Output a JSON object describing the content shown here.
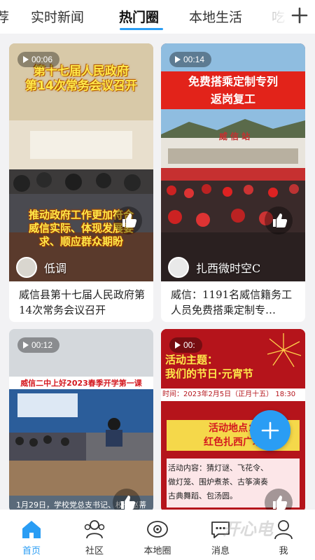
{
  "tabs": [
    "荐",
    "实时新闻",
    "热门圈",
    "本地生活",
    "吃"
  ],
  "active_tab": "热门圈",
  "cards": [
    {
      "duration": "00:06",
      "headline_top": "第十七届人民政府\n第14次常务会议召开",
      "headline_bottom": "推动政府工作更加符合\n威信实际、体现发展要\n求、顺应群众期盼",
      "author": "低调",
      "caption": "威信县第十七届人民政府第14次常务会议召开"
    },
    {
      "duration": "00:14",
      "headline_top": "免费搭乘定制专列\n返岗复工",
      "station_sign": "威 信 站",
      "author": "扎西微时空C",
      "caption": "威信：1191名威信籍务工人员免费搭乘定制专…"
    },
    {
      "duration": "00:12",
      "headline_top": "威信二中上好2023春季开学第一课",
      "bottom_text": "1月29日，学校党总支书记、校长赵蒂"
    },
    {
      "duration": "00:",
      "headline_top": "活动主题：\n我们的节日·元宵节",
      "date_line": "时间：2023年2月5日（正月十五） 18:30",
      "location": "活动地点：\n红色扎西广场",
      "activities": "活动内容：猜灯谜、飞花令、\n做灯笼、围炉煮茶、古筝演奏\n古典舞蹈、包汤圆。"
    }
  ],
  "bottom_nav": [
    {
      "label": "首页",
      "icon": "home-icon"
    },
    {
      "label": "社区",
      "icon": "community-icon"
    },
    {
      "label": "本地圈",
      "icon": "local-circle-icon"
    },
    {
      "label": "消息",
      "icon": "message-icon"
    },
    {
      "label": "我",
      "icon": "profile-icon"
    }
  ],
  "watermark": "开心电",
  "colors": {
    "accent": "#2a9df4",
    "headline_yellow": "#ffe94a",
    "festival_red": "#b5141b"
  }
}
